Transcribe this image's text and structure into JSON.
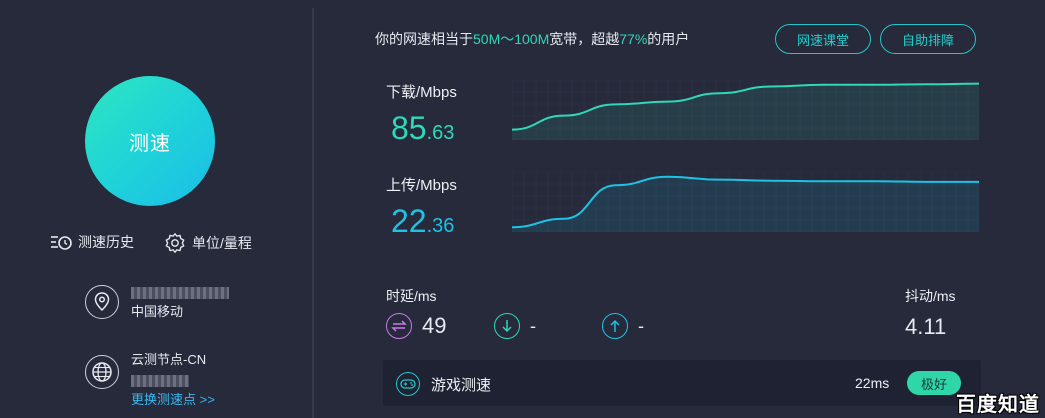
{
  "left": {
    "start_button": "测速",
    "history_label": "测速历史",
    "unit_label": "单位/量程",
    "isp": {
      "ip_partial": "1▇▇.206",
      "name": "中国移动"
    },
    "node": {
      "title": "云测节点-CN",
      "change_link": "更换测速点 >>"
    }
  },
  "headline": {
    "prefix": "你的网速相当于",
    "bandwidth": "50M～100M",
    "middle": "宽带，超越",
    "percent": "77%",
    "suffix": "的用户"
  },
  "buttons": {
    "class_label": "网速课堂",
    "help_label": "自助排障"
  },
  "download": {
    "label": "下载/Mbps",
    "int": "85",
    "dec": ".63"
  },
  "upload": {
    "label": "上传/Mbps",
    "int": "22",
    "dec": ".36"
  },
  "latency": {
    "label": "时延/ms",
    "value": "49",
    "down_value": "-",
    "up_value": "-"
  },
  "jitter": {
    "label": "抖动/ms",
    "value": "4.11"
  },
  "game": {
    "label": "游戏测速",
    "ms": "22ms",
    "rating": "极好"
  },
  "watermark": "百度知道",
  "colors": {
    "download": "#2ed8b8",
    "upload": "#1cc3e6",
    "latency": "#c97be8",
    "accent": "#22c6c9"
  },
  "chart_data": [
    {
      "type": "area",
      "series": [
        {
          "name": "下载/Mbps",
          "values": [
            0.85,
            0.6,
            0.4,
            0.35,
            0.2,
            0.08,
            0.05,
            0.05,
            0.04,
            0.03
          ]
        }
      ]
    },
    {
      "type": "area",
      "series": [
        {
          "name": "上传/Mbps",
          "values": [
            0.95,
            0.8,
            0.2,
            0.05,
            0.1,
            0.12,
            0.13,
            0.13,
            0.14,
            0.14
          ]
        }
      ]
    }
  ]
}
